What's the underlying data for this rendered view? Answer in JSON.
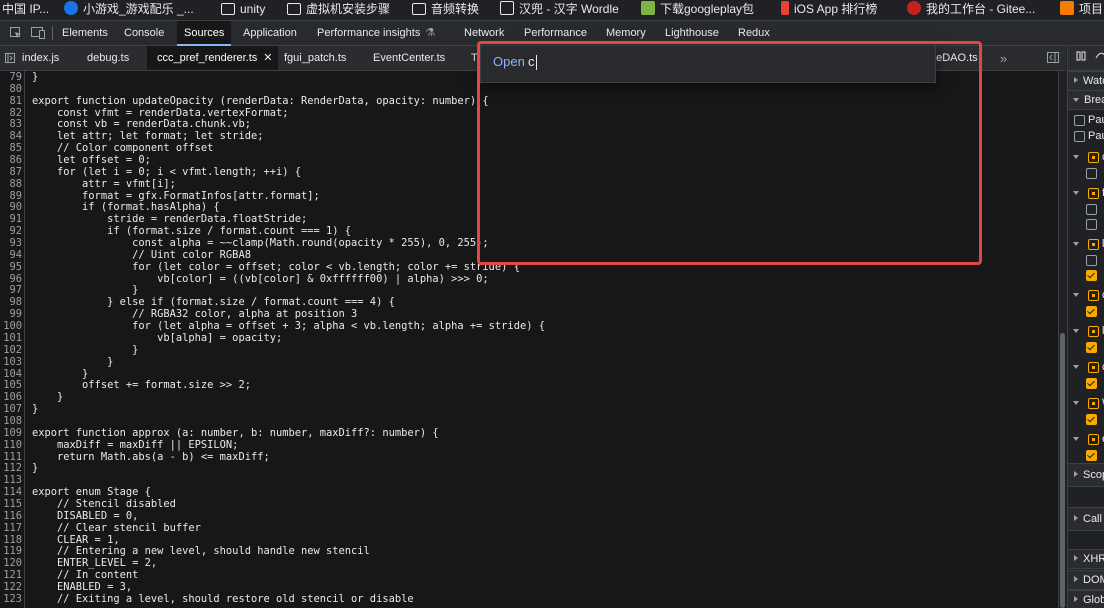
{
  "bookmarks": [
    {
      "label": "中国 IP...",
      "color": "#5f6368"
    },
    {
      "label": "小游戏_游戏配乐 _...",
      "color": "#1a73e8"
    },
    {
      "label": "unity",
      "color": "#e8eaed"
    },
    {
      "label": "虚拟机安装步骤",
      "color": "#e8eaed"
    },
    {
      "label": "音频转换",
      "color": "#e8eaed"
    },
    {
      "label": "汉兜 - 汉字 Wordle",
      "color": "#e8eaed"
    },
    {
      "label": "下载googleplay包",
      "color": "#7cb342"
    },
    {
      "label": "iOS App 排行榜",
      "color": "#ea4335"
    },
    {
      "label": "我的工作台 - Gitee...",
      "color": "#c5221f"
    },
    {
      "label": "项目",
      "color": "#f57c00"
    }
  ],
  "panel_tabs": [
    "Elements",
    "Console",
    "Sources",
    "Application",
    "Performance insights",
    "Network",
    "Performance",
    "Memory",
    "Lighthouse",
    "Redux"
  ],
  "active_panel": "Sources",
  "file_tabs": [
    "index.js",
    "debug.ts",
    "ccc_pref_renderer.ts",
    "fgui_patch.ts",
    "EventCenter.ts",
    "T",
    "geDAO.ts"
  ],
  "active_file": "ccc_pref_renderer.ts",
  "quick_open": {
    "prefix": "Open",
    "query": "c"
  },
  "code_lines": [
    {
      "n": "79",
      "t": "}"
    },
    {
      "n": "80",
      "t": ""
    },
    {
      "n": "81",
      "t": "export function updateOpacity (renderData: RenderData, opacity: number) {"
    },
    {
      "n": "82",
      "t": "    const vfmt = renderData.vertexFormat;"
    },
    {
      "n": "83",
      "t": "    const vb = renderData.chunk.vb;"
    },
    {
      "n": "84",
      "t": "    let attr; let format; let stride;"
    },
    {
      "n": "85",
      "t": "    // Color component offset"
    },
    {
      "n": "86",
      "t": "    let offset = 0;"
    },
    {
      "n": "87",
      "t": "    for (let i = 0; i < vfmt.length; ++i) {"
    },
    {
      "n": "88",
      "t": "        attr = vfmt[i];"
    },
    {
      "n": "89",
      "t": "        format = gfx.FormatInfos[attr.format];"
    },
    {
      "n": "90",
      "t": "        if (format.hasAlpha) {"
    },
    {
      "n": "91",
      "t": "            stride = renderData.floatStride;"
    },
    {
      "n": "92",
      "t": "            if (format.size / format.count === 1) {"
    },
    {
      "n": "93",
      "t": "                const alpha = ~~clamp(Math.round(opacity * 255), 0, 255);"
    },
    {
      "n": "94",
      "t": "                // Uint color RGBA8"
    },
    {
      "n": "95",
      "t": "                for (let color = offset; color < vb.length; color += stride) {"
    },
    {
      "n": "96",
      "t": "                    vb[color] = ((vb[color] & 0xffffff00) | alpha) >>> 0;"
    },
    {
      "n": "97",
      "t": "                }"
    },
    {
      "n": "98",
      "t": "            } else if (format.size / format.count === 4) {"
    },
    {
      "n": "99",
      "t": "                // RGBA32 color, alpha at position 3"
    },
    {
      "n": "100",
      "t": "                for (let alpha = offset + 3; alpha < vb.length; alpha += stride) {"
    },
    {
      "n": "101",
      "t": "                    vb[alpha] = opacity;"
    },
    {
      "n": "102",
      "t": "                }"
    },
    {
      "n": "103",
      "t": "            }"
    },
    {
      "n": "104",
      "t": "        }"
    },
    {
      "n": "105",
      "t": "        offset += format.size >> 2;"
    },
    {
      "n": "106",
      "t": "    }"
    },
    {
      "n": "107",
      "t": "}"
    },
    {
      "n": "108",
      "t": ""
    },
    {
      "n": "109",
      "t": "export function approx (a: number, b: number, maxDiff?: number) {"
    },
    {
      "n": "110",
      "t": "    maxDiff = maxDiff || EPSILON;"
    },
    {
      "n": "111",
      "t": "    return Math.abs(a - b) <= maxDiff;"
    },
    {
      "n": "112",
      "t": "}"
    },
    {
      "n": "113",
      "t": ""
    },
    {
      "n": "114",
      "t": "export enum Stage {"
    },
    {
      "n": "115",
      "t": "    // Stencil disabled"
    },
    {
      "n": "116",
      "t": "    DISABLED = 0,"
    },
    {
      "n": "117",
      "t": "    // Clear stencil buffer"
    },
    {
      "n": "118",
      "t": "    CLEAR = 1,"
    },
    {
      "n": "119",
      "t": "    // Entering a new level, should handle new stencil"
    },
    {
      "n": "120",
      "t": "    ENTER_LEVEL = 2,"
    },
    {
      "n": "121",
      "t": "    // In content"
    },
    {
      "n": "122",
      "t": "    ENABLED = 3,"
    },
    {
      "n": "123",
      "t": "    // Exiting a level, should restore old stencil or disable"
    }
  ],
  "sidebar": {
    "watch": "Watch",
    "breakpoints": "Breakpoints",
    "pause_uncaught": "Pause on uncaught exceptions",
    "pause_caught": "Pause on caught exceptions",
    "scope": "Scope",
    "call_stack": "Call Stack",
    "xhr": "XHR/fetch Breakpoints",
    "dom": "DOM Breakpoints",
    "global": "Global Listeners",
    "breakpoint_groups": [
      {
        "file": "c",
        "checked": [
          false
        ]
      },
      {
        "file": "f",
        "checked": [
          false,
          false
        ]
      },
      {
        "file": "l",
        "checked": [
          false,
          true
        ]
      },
      {
        "file": "c",
        "checked": [
          true
        ]
      },
      {
        "file": "l",
        "checked": [
          true
        ]
      },
      {
        "file": "c",
        "checked": [
          true
        ]
      },
      {
        "file": "W",
        "checked": [
          true
        ]
      },
      {
        "file": "e",
        "checked": [
          true
        ]
      }
    ]
  }
}
